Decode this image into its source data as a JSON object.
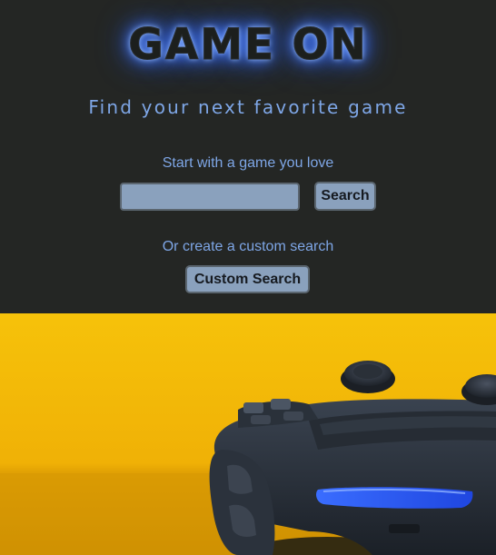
{
  "hero": {
    "title": "GAME ON",
    "subtitle": "Find your next favorite game",
    "title_glow_color": "#2f63ff",
    "text_color": "#7ea6e6",
    "background_color": "#242624"
  },
  "search": {
    "prompt": "Start with a game you love",
    "input_value": "",
    "button_label": "Search"
  },
  "custom": {
    "prompt": "Or create a custom search",
    "button_label": "Custom Search"
  },
  "banner": {
    "image": "game-controller-photo",
    "background_color": "#f2b705",
    "lightbar_color": "#2a5cff"
  }
}
